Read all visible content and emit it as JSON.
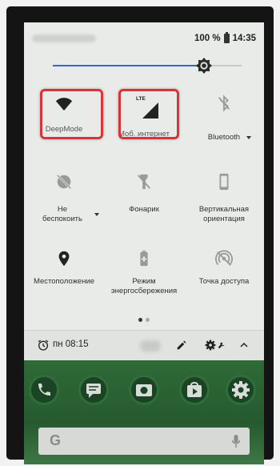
{
  "status_bar": {
    "battery_text": "100 %",
    "time": "14:35"
  },
  "brightness": {
    "level": 0.8
  },
  "tiles": [
    {
      "id": "wifi",
      "label": "DeepMode",
      "icon": "wifi-icon",
      "highlighted": true
    },
    {
      "id": "mobile-data",
      "label": "Моб. интернет",
      "icon": "signal-icon",
      "badge": "LTE",
      "highlighted": true
    },
    {
      "id": "bluetooth",
      "label": "Bluetooth",
      "icon": "bluetooth-off-icon",
      "dropdown": true
    },
    {
      "id": "dnd",
      "label": "Не беспокоить",
      "icon": "do-not-disturb-icon",
      "dropdown": true
    },
    {
      "id": "flashlight",
      "label": "Фонарик",
      "icon": "flashlight-icon"
    },
    {
      "id": "rotation",
      "label": "Вертикальная ориентация",
      "icon": "portrait-phone-icon"
    },
    {
      "id": "location",
      "label": "Местоположение",
      "icon": "location-pin-icon"
    },
    {
      "id": "battery-saver",
      "label": "Режим энергосбережения",
      "icon": "battery-saver-icon"
    },
    {
      "id": "hotspot",
      "label": "Точка доступа",
      "icon": "hotspot-off-icon"
    }
  ],
  "pager": {
    "current": 1,
    "total": 2
  },
  "footer": {
    "alarm_text": "пн 08:15",
    "icons": [
      "alarm-icon",
      "edit-icon",
      "settings-icon",
      "collapse-icon"
    ]
  },
  "home": {
    "dock_icons": [
      "phone-icon",
      "messages-icon",
      "camera-icon",
      "play-store-icon",
      "settings-app-icon"
    ],
    "search_letter": "G"
  },
  "colors": {
    "highlight": "#d9343a",
    "accent": "#2e6cc4",
    "panel_bg": "#e9ebe9",
    "home_bg": "#2e6a38"
  }
}
